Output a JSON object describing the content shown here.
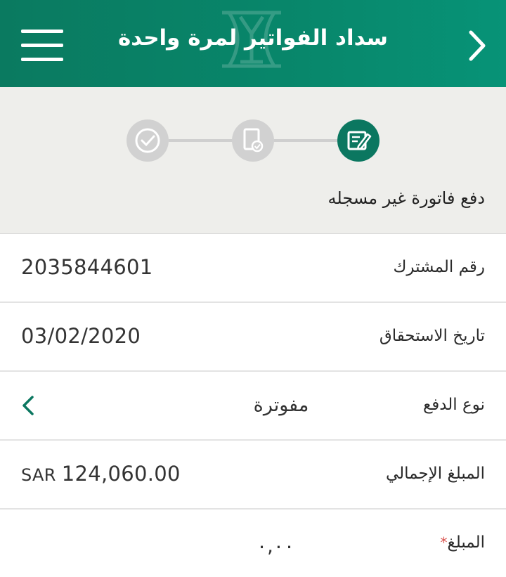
{
  "header": {
    "title": "سداد الفواتير لمرة واحدة",
    "menu_icon": "hamburger-menu-icon",
    "back_icon": "chevron-right-icon",
    "brand_color": "#0a7f64"
  },
  "stepper": {
    "steps": [
      {
        "icon": "edit-form-icon",
        "state": "active"
      },
      {
        "icon": "document-check-icon",
        "state": "inactive"
      },
      {
        "icon": "check-circle-icon",
        "state": "inactive"
      }
    ],
    "section_title": "دفع فاتورة غير مسجله"
  },
  "form": {
    "subscriber": {
      "label": "رقم المشترك",
      "value": "2035844601"
    },
    "due_date": {
      "label": "تاريخ الاستحقاق",
      "value": "03/02/2020"
    },
    "payment_type": {
      "label": "نوع الدفع",
      "value": "مفوترة"
    },
    "total": {
      "label": "المبلغ الإجمالي",
      "currency": "SAR",
      "value": "124,060.00"
    },
    "amount": {
      "label": "المبلغ",
      "required_mark": "*",
      "value": "٠,٠٠"
    }
  }
}
